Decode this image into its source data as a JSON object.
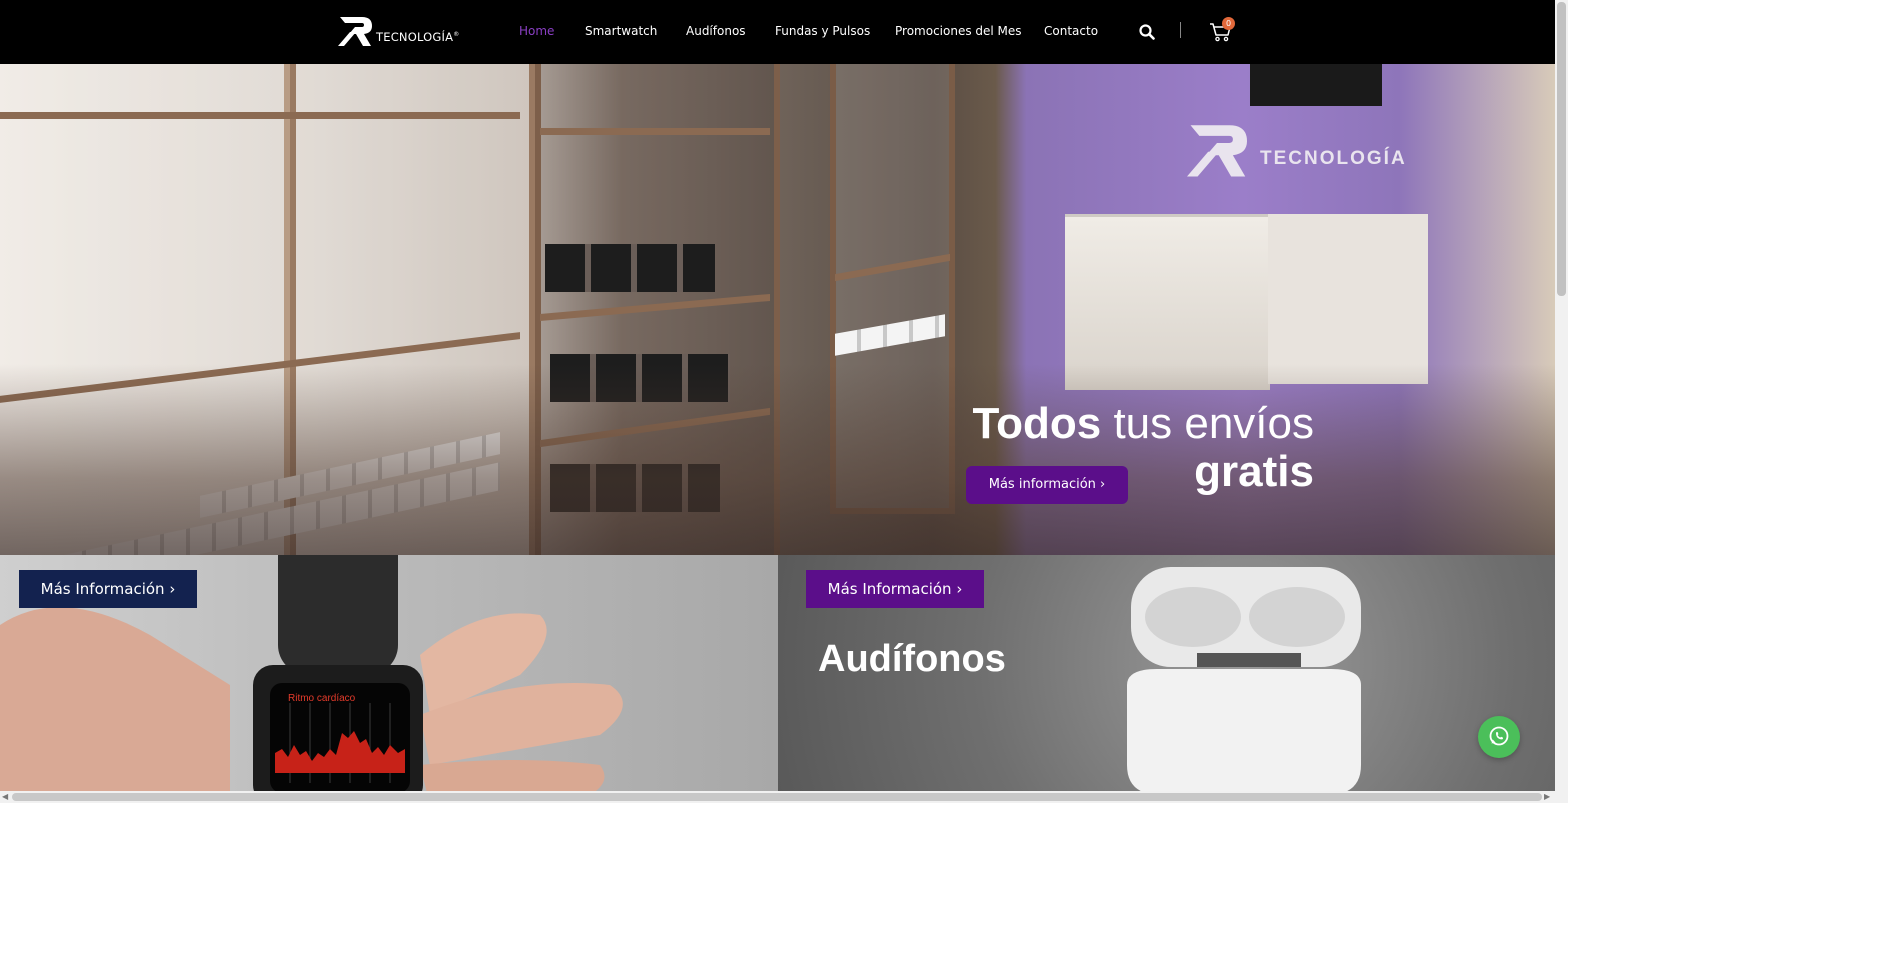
{
  "header": {
    "logo": {
      "text": "TECNOLOGÍA",
      "reg": "®"
    },
    "nav": [
      {
        "label": "Home",
        "active": true
      },
      {
        "label": "Smartwatch"
      },
      {
        "label": "Audífonos"
      },
      {
        "label": "Fundas y Pulsos"
      },
      {
        "label": "Promociones del Mes"
      },
      {
        "label": "Contacto"
      }
    ],
    "cart_count": "0",
    "icons": {
      "search": "search-icon",
      "cart": "cart-icon"
    },
    "colors": {
      "background": "#000000",
      "active": "#8a3fc4",
      "badge": "#e2683a"
    }
  },
  "hero": {
    "title_bold": "Todos",
    "title_rest": " tus envíos",
    "title_line2": "gratis",
    "button_label": "Más información ›",
    "wall_logo_text": "TECNOLOGÍA",
    "colors": {
      "button": "#5b0e8a"
    }
  },
  "cards": [
    {
      "button_label": "Más Información ›",
      "watch_label": "Ritmo cardíaco",
      "color": "#13224f"
    },
    {
      "button_label": "Más Información ›",
      "title": "Audífonos",
      "color": "#5b0e8a"
    }
  ],
  "widgets": {
    "whatsapp": "whatsapp-icon"
  }
}
